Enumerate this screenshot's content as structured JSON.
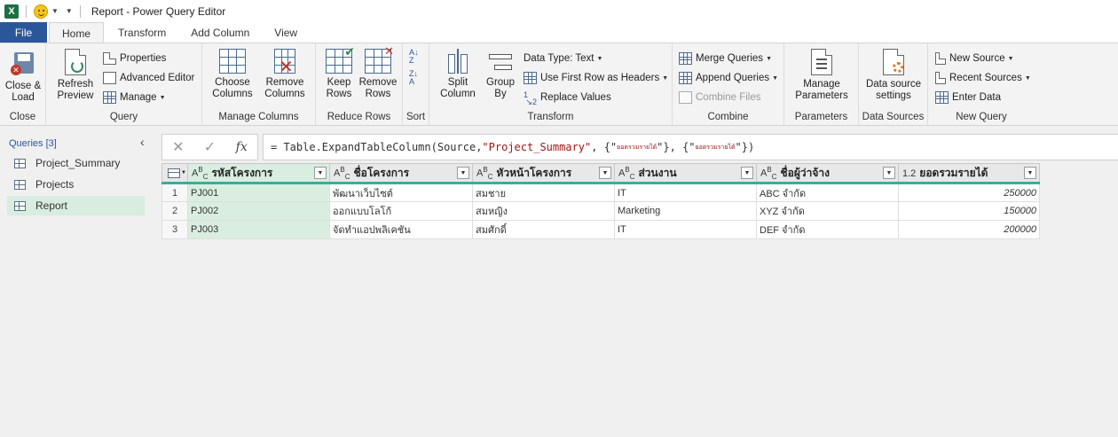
{
  "titlebar": {
    "title": "Report - Power Query Editor",
    "app_icon": "X"
  },
  "tabs": {
    "file": "File",
    "items": [
      "Home",
      "Transform",
      "Add Column",
      "View"
    ],
    "active": "Home"
  },
  "ribbon": {
    "close": {
      "close_load": "Close &\nLoad",
      "label": "Close"
    },
    "query": {
      "refresh": "Refresh\nPreview",
      "properties": "Properties",
      "advanced_editor": "Advanced Editor",
      "manage": "Manage",
      "label": "Query"
    },
    "manage_columns": {
      "choose": "Choose\nColumns",
      "remove": "Remove\nColumns",
      "label": "Manage Columns"
    },
    "reduce_rows": {
      "keep": "Keep\nRows",
      "remove": "Remove\nRows",
      "label": "Reduce Rows"
    },
    "sort": {
      "label": "Sort"
    },
    "transform": {
      "split": "Split\nColumn",
      "group_by": "Group\nBy",
      "data_type": "Data Type: Text",
      "first_row": "Use First Row as Headers",
      "replace": "Replace Values",
      "label": "Transform"
    },
    "combine": {
      "merge": "Merge Queries",
      "append": "Append Queries",
      "combine_files": "Combine Files",
      "label": "Combine"
    },
    "parameters": {
      "manage": "Manage\nParameters",
      "label": "Parameters"
    },
    "data_sources": {
      "settings": "Data source\nsettings",
      "label": "Data Sources"
    },
    "new_query": {
      "new_source": "New Source",
      "recent": "Recent Sources",
      "enter_data": "Enter Data",
      "label": "New Query"
    }
  },
  "sidebar": {
    "header": "Queries [3]",
    "items": [
      {
        "label": "Project_Summary"
      },
      {
        "label": "Projects"
      },
      {
        "label": "Report"
      }
    ],
    "selected": "Report"
  },
  "formula": {
    "prefix": "= Table.ExpandTableColumn(Source, ",
    "str1": "\"Project_Summary\"",
    "mid1": ", {\"",
    "thai1": "ยอดรวมรายได้",
    "mid2": "\"}, {\"",
    "thai2": "ยอดรวมรายได้",
    "suffix": "\"})"
  },
  "grid": {
    "columns": [
      {
        "type": "ABC",
        "name": "รหัสโครงการ"
      },
      {
        "type": "ABC",
        "name": "ชื่อโครงการ"
      },
      {
        "type": "ABC",
        "name": "หัวหน้าโครงการ"
      },
      {
        "type": "ABC",
        "name": "ส่วนงาน"
      },
      {
        "type": "ABC",
        "name": "ชื่อผู้ว่าจ้าง"
      },
      {
        "type": "1.2",
        "name": "ยอดรวมรายได้"
      }
    ],
    "rows": [
      {
        "n": "1",
        "cells": [
          "PJ001",
          "พัฒนาเว็บไซต์",
          "สมชาย",
          "IT",
          "ABC จำกัด",
          "250000"
        ]
      },
      {
        "n": "2",
        "cells": [
          "PJ002",
          "ออกแบบโลโก้",
          "สมหญิง",
          "Marketing",
          "XYZ จำกัด",
          "150000"
        ]
      },
      {
        "n": "3",
        "cells": [
          "PJ003",
          "จัดทำแอปพลิเคชัน",
          "สมศักดิ์",
          "IT",
          "DEF จำกัด",
          "200000"
        ]
      }
    ]
  }
}
